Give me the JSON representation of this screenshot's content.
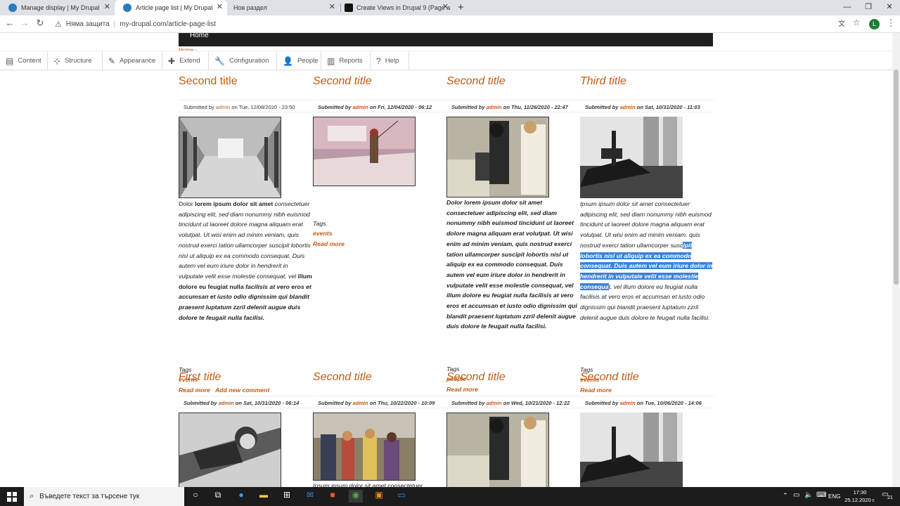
{
  "browser": {
    "tabs": [
      {
        "label": "Manage display | My Drupal"
      },
      {
        "label": "Article page list | My Drupal"
      },
      {
        "label": "Нов раздел"
      },
      {
        "label": "Create Views in Drupal 9 (Page a"
      }
    ],
    "security_label": "Няма защита",
    "url": "my-drupal.com/article-page-list",
    "profile_initial": "L"
  },
  "site": {
    "home_link": "Home",
    "breadcrumb": "Home ›"
  },
  "admin_menu": [
    {
      "label": "Content",
      "icon": "content-icon"
    },
    {
      "label": "Structure",
      "icon": "structure-icon"
    },
    {
      "label": "Appearance",
      "icon": "appearance-icon"
    },
    {
      "label": "Extend",
      "icon": "extend-icon"
    },
    {
      "label": "Configuration",
      "icon": "configuration-icon"
    },
    {
      "label": "People",
      "icon": "people-icon"
    },
    {
      "label": "Reports",
      "icon": "reports-icon"
    },
    {
      "label": "Help",
      "icon": "help-icon"
    }
  ],
  "articles_row1": [
    {
      "title": "Second title",
      "submitted_prefix": "Submitted by",
      "author": "admin",
      "submitted_suffix": "on Tue, 12/08/2020 - 23:50",
      "image": "photo-museum-hall",
      "body_start": "Dolor",
      "body_bold": "lorem ipsum dolor sit amet",
      "body_italic": "consectetuer adipiscing elit, sed diam nonummy nibh euismod tincidunt ut laoreet dolore magna aliquam erat volutpat. Ut wisi enim ad minim veniam, quis nostrud exerci tation ullamcorper suscipit lobortis nisl ut aliquip ex ea commodo consequat. Duis autem vel eum iriure dolor in hendrerit in vulputate velit esse molestie consequat, vel",
      "body_bold2": "illum dolore eu feugiat nulla",
      "body_end": "facilisis at vero eros et accumsan et iusto odio dignissim qui blandit praesent luptatum zzril delenit augue duis dolore te feugait nulla facilisi.",
      "tags_label": "Tags",
      "tag": "events",
      "read_more": "Read more",
      "add_comment": "Add new comment"
    },
    {
      "title": "Second title",
      "submitted_prefix": "Submitted by",
      "author": "admin",
      "submitted_suffix": "on Fri, 12/04/2020 - 06:12",
      "image": "photo-fisherman-pier",
      "tags_label": "Tags",
      "tag": "events",
      "read_more": "Read more"
    },
    {
      "title": "Second title",
      "submitted_prefix": "Submitted by",
      "author": "admin",
      "submitted_suffix": "on Thu, 11/26/2020 - 22:47",
      "image": "photo-office-computer",
      "body": "Dolor lorem ipsum dolor sit amet consectetuer adipiscing elit, sed diam nonummy nibh euismod tincidunt ut laoreet dolore magna aliquam erat volutpat. Ut wisi enim ad minim veniam, quis nostrud exerci tation ullamcorper suscipit lobortis nisl ut aliquip ex ea commodo consequat. Duis autem vel eum iriure dolor in hendrerit in vulputate velit esse molestie consequat, vel illum dolore eu feugiat nulla facilisis at vero eros et accumsan et iusto odio dignissim qui blandit praesent luptatum zzril delenit augue duis dolore te feugait nulla facilisi.",
      "tags_label": "Tags",
      "tag": "people",
      "read_more": "Read more"
    },
    {
      "title": "Third title",
      "submitted_prefix": "Submitted by",
      "author": "admin",
      "submitted_suffix": "on Sat, 10/31/2020 - 11:03",
      "image": "photo-tower-bridge-ship",
      "body_before": "Ipsum ipsum dolor sit amet consectetuer adipiscing elit, sed diam nonummy nibh euismod tincidunt ut laoreet dolore magna aliquam erat volutpat. Ut wisi enim ad minim veniam, quis nostrud exerci tation ullamcorper susc",
      "body_selected": "ipit lobortis nisl ut aliquip ex ea commodo consequat. Duis autem vel eum iriure dolor in hendrerit in vulputate velit esse molestie consequa",
      "body_after": "t, vel illum dolore eu feugiat nulla facilisis at vero eros et accumsan et iusto odio dignissim qui blandit praesent luptatum zzril delenit augue duis dolore te feugait nulla facilisi.",
      "tags_label": "Tags",
      "tag": "events",
      "read_more": "Read more"
    }
  ],
  "articles_row2": [
    {
      "title": "First title",
      "submitted_prefix": "Submitted by",
      "author": "admin",
      "submitted_suffix": "on Sat, 10/31/2020 - 06:14",
      "image": "photo-aviator"
    },
    {
      "title": "Second title",
      "submitted_prefix": "Submitted by",
      "author": "admin",
      "submitted_suffix": "on Thu, 10/22/2020 - 10:09",
      "image": "photo-street-shoppers",
      "body_peek": "Ipsum ipsum dolor sit amet consectetuer"
    },
    {
      "title": "Second title",
      "submitted_prefix": "Submitted by",
      "author": "admin",
      "submitted_suffix": "on Wed, 10/21/2020 - 12:22",
      "image": "photo-office-computer"
    },
    {
      "title": "Second title",
      "submitted_prefix": "Submitted by",
      "author": "admin",
      "submitted_suffix": "on Tue, 10/06/2020 - 14:06",
      "image": "photo-tower-bridge-ship"
    }
  ],
  "taskbar": {
    "search_placeholder": "Въведете текст за търсене тук",
    "lang": "ENG",
    "time": "17:30",
    "date": "25.12.2020 г.",
    "notifications": "21"
  },
  "colors": {
    "link": "#c55a11",
    "selection": "#3b82d9",
    "taskbar": "#1c1c1c"
  }
}
